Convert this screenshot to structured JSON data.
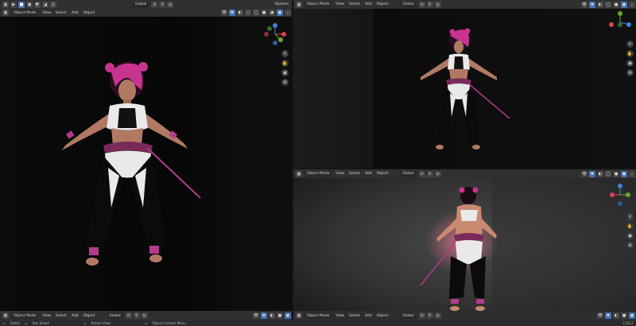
{
  "topbar": {
    "scene_label": "Global",
    "options_label": "Options"
  },
  "viewports": [
    {
      "id": "left",
      "mode": "Object Mode",
      "menus": [
        "View",
        "Select",
        "Add",
        "Object"
      ],
      "transform": "Global",
      "background": "#0a0a0a"
    },
    {
      "id": "top-right",
      "mode": "Object Mode",
      "menus": [
        "View",
        "Select",
        "Add",
        "Object"
      ],
      "transform": "Global",
      "background": "#151515"
    },
    {
      "id": "bottom-right",
      "mode": "Object Mode",
      "menus": [
        "View",
        "Select",
        "Add",
        "Object"
      ],
      "transform": "Global",
      "background": "#3a3a3a"
    }
  ],
  "bottom_headers": [
    {
      "mode": "Object Mode",
      "menus": [
        "View",
        "Select",
        "Add",
        "Object"
      ],
      "transform": "Global"
    },
    {
      "mode": "Object Mode",
      "menus": [
        "View",
        "Select",
        "Add",
        "Object"
      ],
      "transform": "Global"
    }
  ],
  "gizmo": {
    "x": "X",
    "y": "Y",
    "z": "Z"
  },
  "gizmo_colors": {
    "x": "#d9434f",
    "y": "#69a72e",
    "z": "#3f82d9"
  },
  "statusbar": {
    "select": "Select",
    "box_select": "Box Select",
    "rotate_view": "Rotate View",
    "context_menu": "Object Context Menu",
    "version": "2.93.3"
  },
  "colors": {
    "accent": "#4772b3",
    "header": "#303030",
    "hair": "#c8338f",
    "outfit": "#e9e9e9",
    "pants": "#0b0b0b",
    "skin": "#b07a62"
  }
}
